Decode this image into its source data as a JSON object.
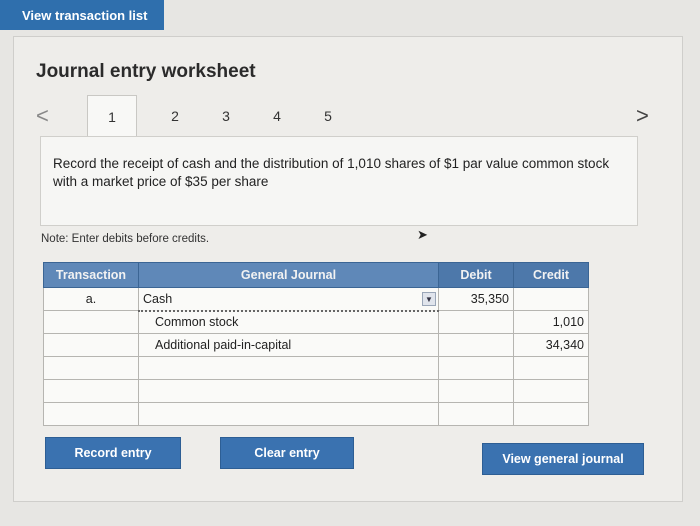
{
  "header": {
    "view_list_label": "View transaction list"
  },
  "worksheet": {
    "title": "Journal entry worksheet",
    "tabs": [
      "1",
      "2",
      "3",
      "4",
      "5"
    ],
    "prev_arrow": "<",
    "next_arrow": ">",
    "instruction": "Record the receipt of cash and the distribution of 1,010 shares of $1 par value common stock with a market price of $35 per share",
    "note": "Note: Enter debits before credits."
  },
  "table": {
    "headers": {
      "transaction": "Transaction",
      "journal": "General Journal",
      "debit": "Debit",
      "credit": "Credit"
    },
    "rows": [
      {
        "transaction": "a.",
        "account": "Cash",
        "debit": "35,350",
        "credit": ""
      },
      {
        "transaction": "",
        "account": "Common stock",
        "debit": "",
        "credit": "1,010"
      },
      {
        "transaction": "",
        "account": "Additional paid-in-capital",
        "debit": "",
        "credit": "34,340"
      },
      {
        "transaction": "",
        "account": "",
        "debit": "",
        "credit": ""
      },
      {
        "transaction": "",
        "account": "",
        "debit": "",
        "credit": ""
      },
      {
        "transaction": "",
        "account": "",
        "debit": "",
        "credit": ""
      }
    ]
  },
  "buttons": {
    "record": "Record entry",
    "clear": "Clear entry",
    "view_journal": "View general journal"
  },
  "colors": {
    "accent": "#3a72b0",
    "header": "#4d78aa"
  }
}
